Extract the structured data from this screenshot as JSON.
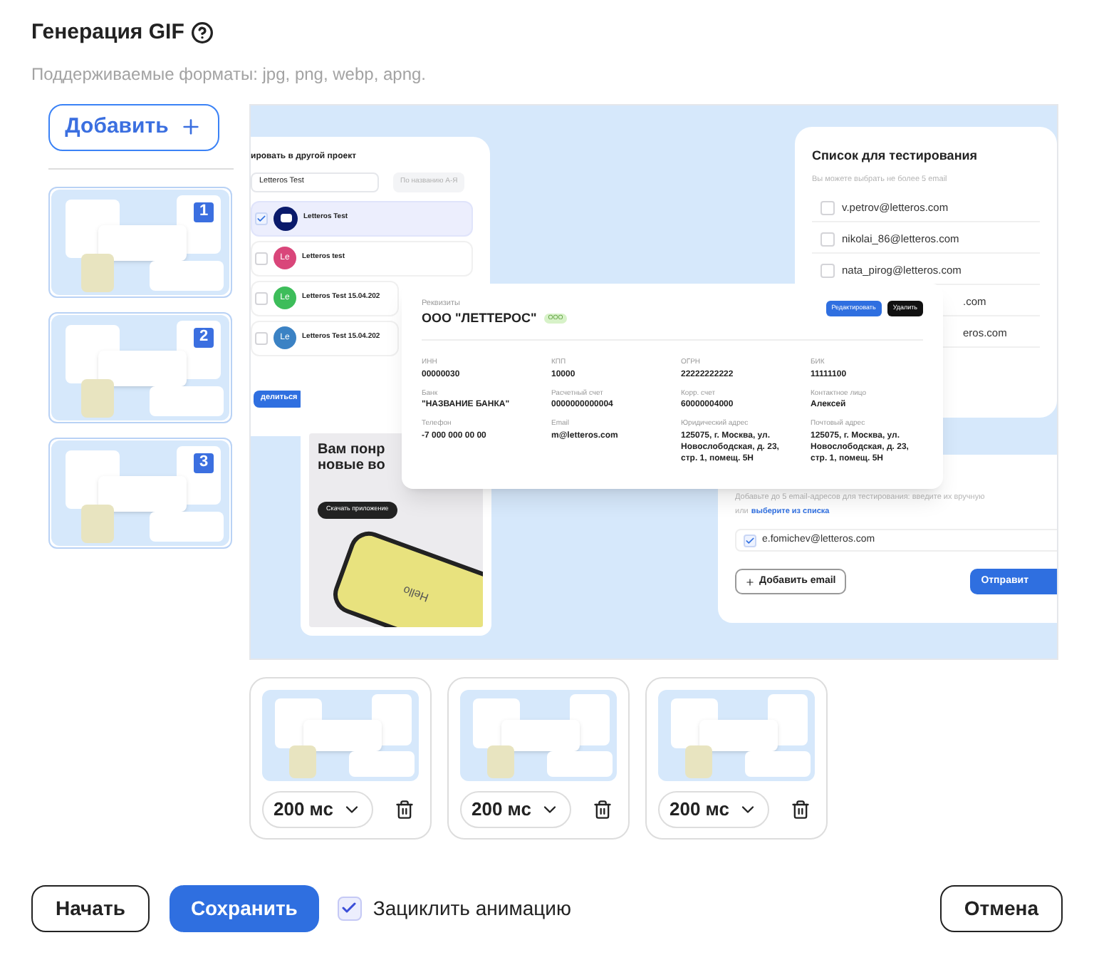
{
  "header": {
    "title": "Генерация GIF",
    "subtitle": "Поддерживаемые форматы: jpg, png, webp, apng."
  },
  "add_button": "Добавить",
  "thumbnails": [
    {
      "number": "1"
    },
    {
      "number": "2"
    },
    {
      "number": "3"
    }
  ],
  "preview": {
    "project_card": {
      "title": "ировать в другой проект",
      "search": "Letteros Test",
      "sort": "По названию А-Я",
      "share_button": "делиться",
      "items": [
        {
          "kind": "logo",
          "name": "Letteros Test",
          "checked": true,
          "color": "#0a1a6b"
        },
        {
          "kind": "initials",
          "initials": "Le",
          "name": "Letteros test",
          "checked": false,
          "color": "#d9467a"
        },
        {
          "kind": "initials",
          "initials": "Le",
          "name": "Letteros Test 15.04.202",
          "checked": false,
          "color": "#3dbd5a"
        },
        {
          "kind": "initials",
          "initials": "Le",
          "name": "Letteros Test 15.04.202",
          "checked": false,
          "color": "#3b82c4"
        }
      ]
    },
    "testing_card": {
      "title": "Список для тестирования",
      "hint": "Вы можете выбрать не более 5 email",
      "emails": [
        {
          "text": "v.petrov@letteros.com",
          "checked": false
        },
        {
          "text": "nikolai_86@letteros.com",
          "checked": false
        },
        {
          "text": "nata_pirog@letteros.com",
          "checked": false
        },
        {
          "text": ".com"
        },
        {
          "text": "eros.com"
        }
      ]
    },
    "requisites_card": {
      "label": "Реквизиты",
      "name": "ООО \"ЛЕТТЕРОС\"",
      "badge": "ООО",
      "edit_button": "Редактировать",
      "delete_button": "Удалить",
      "fields": [
        {
          "label": "ИНН",
          "value": "00000030"
        },
        {
          "label": "КПП",
          "value": "10000"
        },
        {
          "label": "ОГРН",
          "value": "22222222222"
        },
        {
          "label": "БИК",
          "value": "11111100"
        },
        {
          "label": "Банк",
          "value": "\"НАЗВАНИЕ БАНКА\""
        },
        {
          "label": "Расчетный счет",
          "value": "0000000000004"
        },
        {
          "label": "Корр. счет",
          "value": "60000004000"
        },
        {
          "label": "Контактное лицо",
          "value": "Алексей"
        },
        {
          "label": "Телефон",
          "value": "-7 000 000 00 00"
        },
        {
          "label": "Email",
          "value": "m@letteros.com"
        },
        {
          "label": "Юридический адрес",
          "value": "125075, г. Москва, ул. Новослободская, д. 23, стр. 1, помещ. 5Н"
        },
        {
          "label": "Почтовый адрес",
          "value": "125075, г. Москва, ул. Новослободская, д. 23, стр. 1, помещ. 5Н"
        }
      ]
    },
    "banner_card": {
      "headline": "Вам понр новые во",
      "button": "Скачать приложение",
      "phone_text": "Hello"
    },
    "email_card": {
      "hint": "Добавьте до 5 email-адресов для тестирования: введите их вручную",
      "hint_prefix": "или",
      "hint_link": "выберите из списка",
      "email": "e.fomichev@letteros.com",
      "email_checked": true,
      "add_button": "Добавить email",
      "send_button": "Отправит"
    }
  },
  "frames": [
    {
      "duration": "200 мс"
    },
    {
      "duration": "200 мс"
    },
    {
      "duration": "200 мс"
    }
  ],
  "footer": {
    "start_button": "Начать",
    "save_button": "Сохранить",
    "loop": {
      "label": "Зациклить анимацию",
      "checked": true
    },
    "cancel_button": "Отмена"
  }
}
